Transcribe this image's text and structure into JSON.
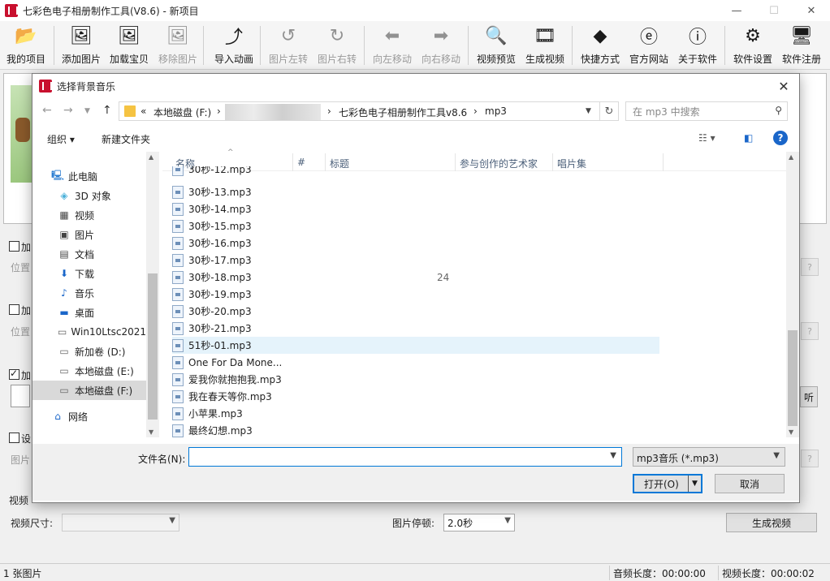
{
  "window": {
    "title": "七彩色电子相册制作工具(V8.6) - 新项目",
    "controls": [
      "—",
      "☐",
      "✕"
    ]
  },
  "toolbar": [
    {
      "name": "my-project-button",
      "icon": "folder-icon",
      "label": "我的项目",
      "enabled": true
    },
    {
      "name": "add-image-button",
      "icon": "add-image-icon",
      "label": "添加图片",
      "enabled": true
    },
    {
      "name": "load-treasure-button",
      "icon": "load-image-icon",
      "label": "加载宝贝",
      "enabled": true
    },
    {
      "name": "remove-image-button",
      "icon": "remove-image-icon",
      "label": "移除图片",
      "enabled": false
    },
    {
      "name": "import-animation-button",
      "icon": "import-icon",
      "label": "导入动画",
      "enabled": true
    },
    {
      "name": "rotate-left-button",
      "icon": "rotate-left-icon",
      "label": "图片左转",
      "enabled": false
    },
    {
      "name": "rotate-right-button",
      "icon": "rotate-right-icon",
      "label": "图片右转",
      "enabled": false
    },
    {
      "name": "move-left-button",
      "icon": "arrow-left-icon",
      "label": "向左移动",
      "enabled": false
    },
    {
      "name": "move-right-button",
      "icon": "arrow-right-icon",
      "label": "向右移动",
      "enabled": false
    },
    {
      "name": "video-preview-button",
      "icon": "magnifier-icon",
      "label": "视频预览",
      "enabled": true
    },
    {
      "name": "generate-video-button",
      "icon": "film-icon",
      "label": "生成视频",
      "enabled": true
    },
    {
      "name": "shortcut-button",
      "icon": "cubes-icon",
      "label": "快捷方式",
      "enabled": true
    },
    {
      "name": "official-site-button",
      "icon": "ie-icon",
      "label": "官方网站",
      "enabled": true
    },
    {
      "name": "about-button",
      "icon": "info-icon",
      "label": "关于软件",
      "enabled": true
    },
    {
      "name": "settings-button",
      "icon": "gear-icon",
      "label": "软件设置",
      "enabled": true
    },
    {
      "name": "register-button",
      "icon": "monitor-icon",
      "label": "软件注册",
      "enabled": true
    }
  ],
  "side": {
    "add1": "加",
    "pos1": "位置",
    "add2": "加",
    "pos2": "位置",
    "add3": "加",
    "set": "设",
    "img": "图片",
    "listen": "听",
    "q": "?",
    "video_section": "视频"
  },
  "bottom": {
    "video_size_label": "视频尺寸:",
    "video_size_value": "",
    "duration_label": "图片停顿:",
    "duration_value": "2.0秒",
    "generate_label": "生成视频"
  },
  "status": {
    "count": "1 张图片",
    "audio_length": "音频长度：00:00:00",
    "video_length": "视频长度：00:00:02"
  },
  "dialog": {
    "title": "选择背景音乐",
    "path": {
      "prefix": "«",
      "drive": "本地磁盘 (F:)",
      "folder1": "七彩色电子相册制作工具v8.6",
      "folder2": "mp3"
    },
    "search_placeholder": "在 mp3 中搜索",
    "organize": "组织 ▾",
    "new_folder": "新建文件夹",
    "nav": [
      {
        "label": "此电脑",
        "icon": "pc-icon"
      },
      {
        "label": "3D 对象",
        "icon": "cube-icon"
      },
      {
        "label": "视频",
        "icon": "video-icon"
      },
      {
        "label": "图片",
        "icon": "pictures-icon"
      },
      {
        "label": "文档",
        "icon": "document-icon"
      },
      {
        "label": "下载",
        "icon": "download-icon"
      },
      {
        "label": "音乐",
        "icon": "music-icon"
      },
      {
        "label": "桌面",
        "icon": "desktop-icon"
      },
      {
        "label": "Win10Ltsc2021",
        "icon": "drive-icon"
      },
      {
        "label": "新加卷 (D:)",
        "icon": "drive-icon"
      },
      {
        "label": "本地磁盘 (E:)",
        "icon": "drive-icon"
      },
      {
        "label": "本地磁盘 (F:)",
        "icon": "drive-icon"
      },
      {
        "label": "网络",
        "icon": "network-icon"
      }
    ],
    "columns": [
      "名称",
      "#",
      "标题",
      "参与创作的艺术家",
      "唱片集"
    ],
    "files": [
      {
        "name": "30秒-12.mp3"
      },
      {
        "name": "30秒-13.mp3"
      },
      {
        "name": "30秒-14.mp3"
      },
      {
        "name": "30秒-15.mp3"
      },
      {
        "name": "30秒-16.mp3"
      },
      {
        "name": "30秒-17.mp3"
      },
      {
        "name": "30秒-18.mp3",
        "num": "24"
      },
      {
        "name": "30秒-19.mp3"
      },
      {
        "name": "30秒-20.mp3"
      },
      {
        "name": "30秒-21.mp3"
      },
      {
        "name": "51秒-01.mp3"
      },
      {
        "name": "One For Da Mone..."
      },
      {
        "name": "爱我你就抱抱我.mp3"
      },
      {
        "name": "我在春天等你.mp3"
      },
      {
        "name": "小苹果.mp3"
      },
      {
        "name": "最终幻想.mp3"
      }
    ],
    "filename_label": "文件名(N):",
    "filename_value": "",
    "filetype": "mp3音乐 (*.mp3)",
    "open": "打开(O)",
    "cancel": "取消"
  },
  "colors": {
    "accent": "#0078d7",
    "annotation_arrow": "#e5382f",
    "highlight_row": "#e5f3fb"
  }
}
